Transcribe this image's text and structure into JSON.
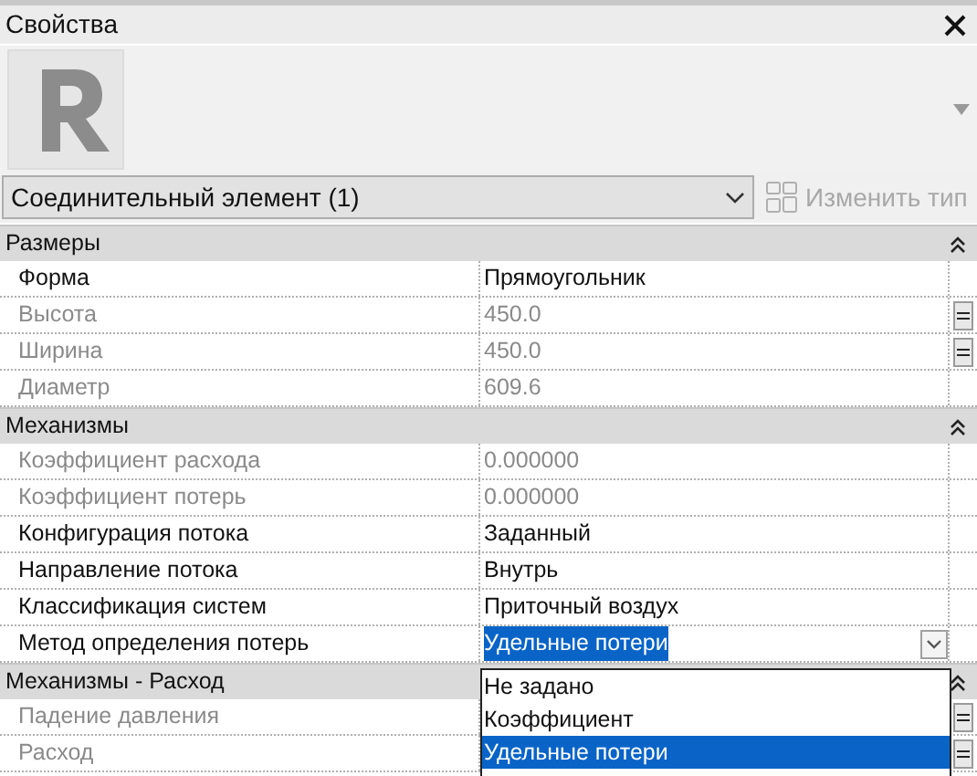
{
  "panel": {
    "title": "Свойства"
  },
  "type_selector": {
    "value": "Соединительный элемент (1)"
  },
  "edit_type_button": {
    "label": "Изменить тип",
    "disabled": true
  },
  "sections": [
    {
      "title": "Размеры",
      "expanded": true,
      "rows": [
        {
          "name": "Форма",
          "value": "Прямоугольник",
          "disabled": false,
          "associate": false
        },
        {
          "name": "Высота",
          "value": "450.0",
          "disabled": true,
          "associate": true
        },
        {
          "name": "Ширина",
          "value": "450.0",
          "disabled": true,
          "associate": true
        },
        {
          "name": "Диаметр",
          "value": "609.6",
          "disabled": true,
          "associate": false
        }
      ]
    },
    {
      "title": "Механизмы",
      "expanded": true,
      "rows": [
        {
          "name": "Коэффициент расхода",
          "value": "0.000000",
          "disabled": true,
          "associate": false
        },
        {
          "name": "Коэффициент потерь",
          "value": "0.000000",
          "disabled": true,
          "associate": false
        },
        {
          "name": "Конфигурация потока",
          "value": "Заданный",
          "disabled": false,
          "associate": false
        },
        {
          "name": "Направление потока",
          "value": "Внутрь",
          "disabled": false,
          "associate": false
        },
        {
          "name": "Классификация систем",
          "value": "Приточный воздух",
          "disabled": false,
          "associate": false
        },
        {
          "name": "Метод определения потерь",
          "value": "Удельные потери",
          "disabled": false,
          "associate": false,
          "kind": "dropdown",
          "open": true,
          "options": [
            {
              "label": "Не задано",
              "selected": false
            },
            {
              "label": "Коэффициент",
              "selected": false
            },
            {
              "label": "Удельные потери",
              "selected": true
            }
          ]
        }
      ]
    },
    {
      "title": "Механизмы - Расход",
      "expanded": true,
      "rows": [
        {
          "name": "Падение давления",
          "disabled": true,
          "associate": true
        },
        {
          "name": "Расход",
          "disabled": true,
          "associate": true
        }
      ]
    }
  ]
}
